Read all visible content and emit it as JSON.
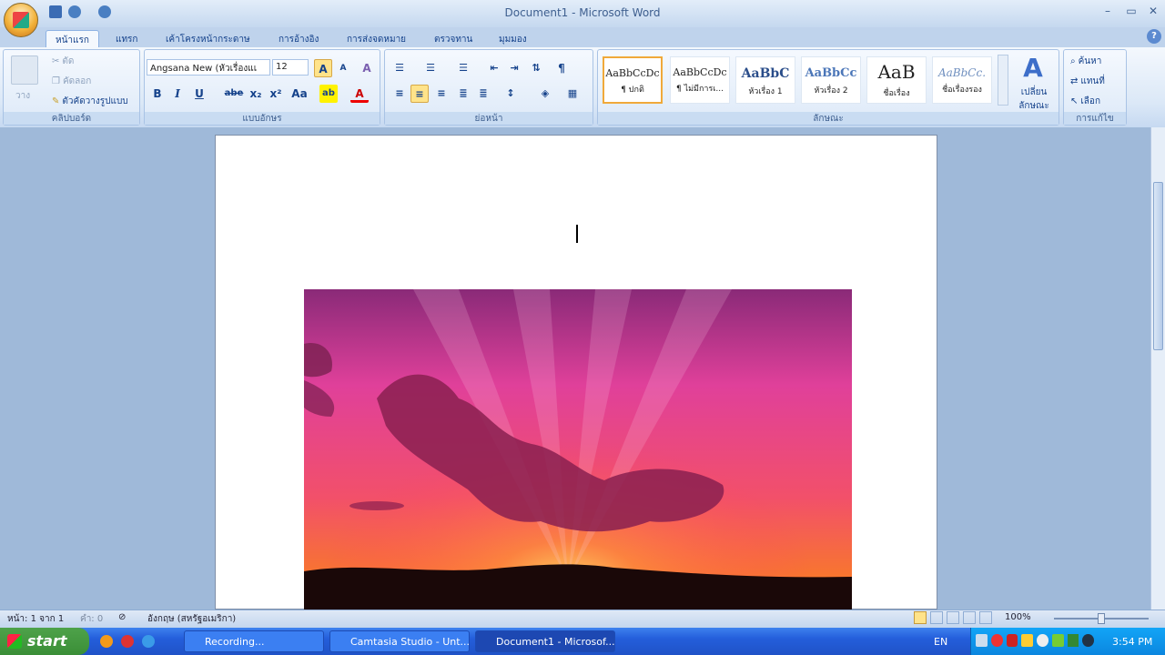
{
  "window": {
    "title": "Document1 - Microsoft Word",
    "minimize": "–",
    "maximize": "▭",
    "close": "✕",
    "help": "?"
  },
  "tabs": [
    "หน้าแรก",
    "แทรก",
    "เค้าโครงหน้ากระดาษ",
    "การอ้างอิง",
    "การส่งจดหมาย",
    "ตรวจทาน",
    "มุมมอง"
  ],
  "clipboard": {
    "paste": "วาง",
    "cut": "ตัด",
    "copy": "คัดลอก",
    "format_painter": "ตัวคัดวางรูปแบบ",
    "label": "คลิปบอร์ด"
  },
  "font": {
    "name": "Angsana New (หัวเรื่องแเ",
    "size": "12",
    "label": "แบบอักษร",
    "bold": "B",
    "italic": "I",
    "underline": "U",
    "strike": "abe",
    "sub": "x₂",
    "sup": "x²",
    "case": "Aa",
    "grow": "A",
    "shrink": "A",
    "clear": "A",
    "highlight": "ab",
    "color": "A"
  },
  "paragraph": {
    "label": "ย่อหน้า",
    "pilcrow": "¶"
  },
  "styles": {
    "label": "ลักษณะ",
    "change": "เปลี่ยน ลักษณะ",
    "items": [
      {
        "sample": "AaBbCcDc",
        "name": "¶ ปกติ"
      },
      {
        "sample": "AaBbCcDc",
        "name": "¶ ไม่มีการเ..."
      },
      {
        "sample": "AaBbC",
        "name": "หัวเรื่อง 1"
      },
      {
        "sample": "AaBbCc",
        "name": "หัวเรื่อง 2"
      },
      {
        "sample": "AaB",
        "name": "ชื่อเรื่อง"
      },
      {
        "sample": "AaBbCc.",
        "name": "ชื่อเรื่องรอง"
      }
    ]
  },
  "editing": {
    "find": "ค้นหา",
    "replace": "แทนที่",
    "select": "เลือก",
    "label": "การแก้ไข"
  },
  "status": {
    "page": "หน้า: 1 จาก 1",
    "words": "คำ: 0",
    "language": "อังกฤษ (สหรัฐอเมริกา)",
    "zoom": "100%"
  },
  "taskbar": {
    "start": "start",
    "tasks": [
      "Recording...",
      "Camtasia Studio - Unt...",
      "Document1 - Microsof..."
    ],
    "lang": "EN",
    "clock": "3:54 PM"
  },
  "colors": {
    "accent": "#15428b",
    "highlight": "#ffe38a",
    "taskbar": "#245edb"
  }
}
